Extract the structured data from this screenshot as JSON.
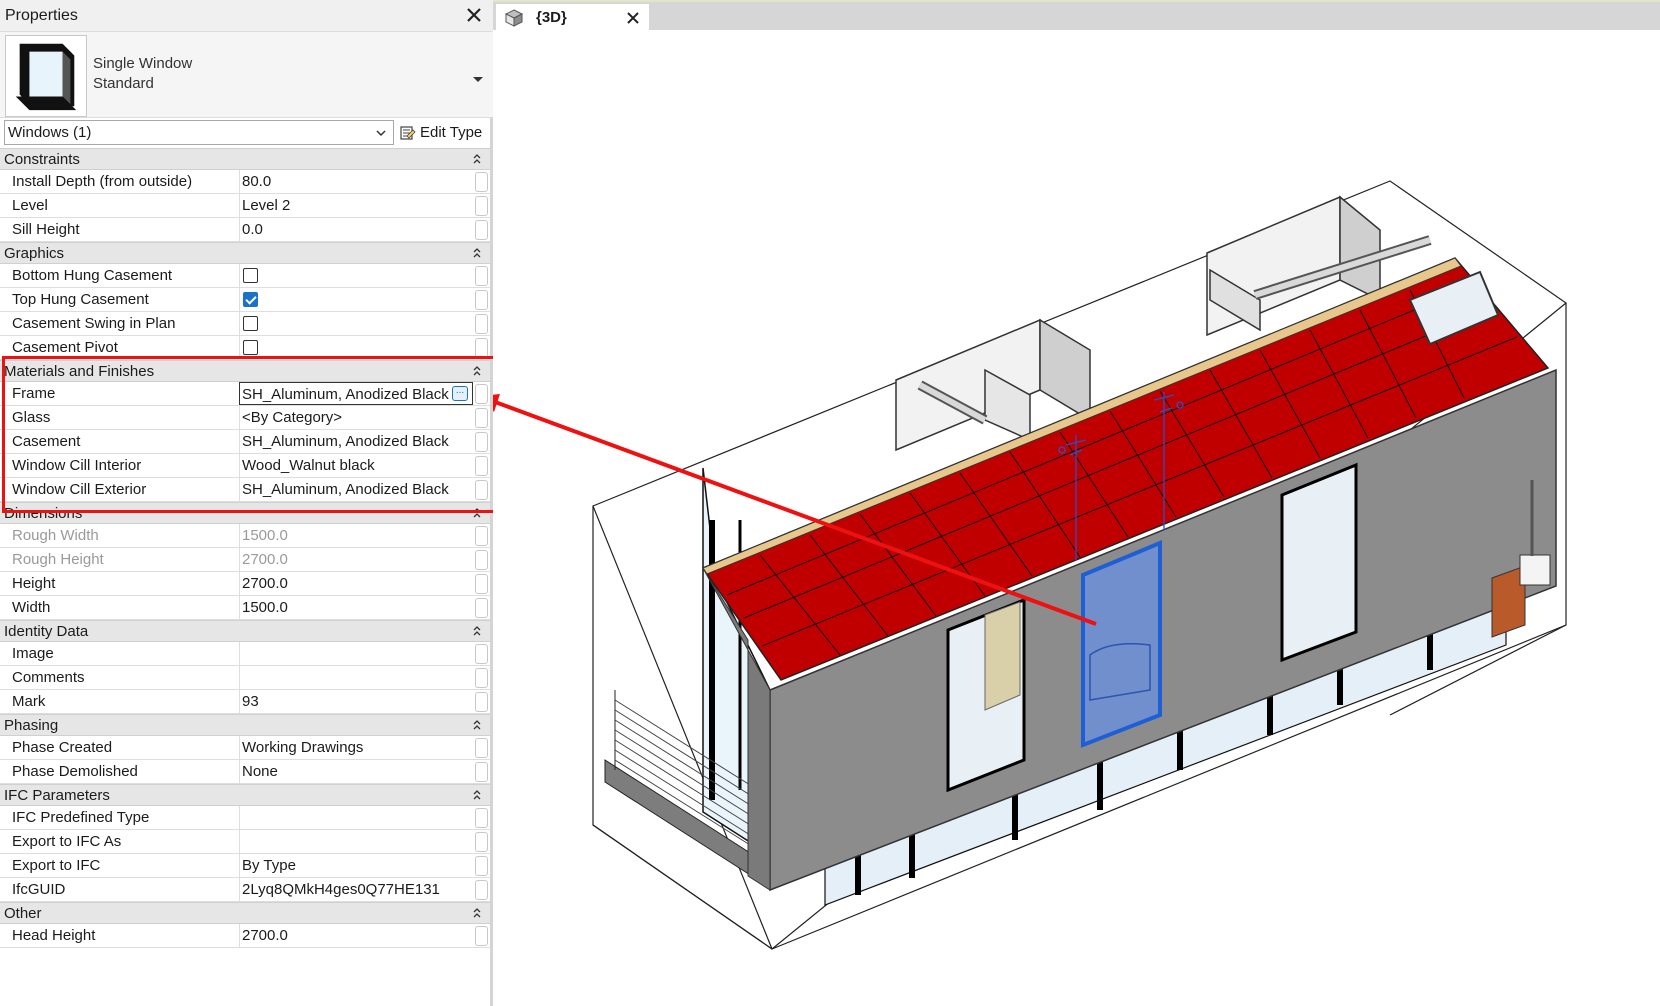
{
  "properties_panel": {
    "title": "Properties",
    "type": {
      "family": "Single Window",
      "type_name": "Standard"
    },
    "selector": {
      "value": "Windows (1)"
    },
    "edit_type_label": "Edit Type",
    "groups": [
      {
        "name": "Constraints",
        "rows": [
          {
            "name": "Install Depth (from outside)",
            "value": "80.0"
          },
          {
            "name": "Level",
            "value": "Level 2"
          },
          {
            "name": "Sill Height",
            "value": "0.0"
          }
        ]
      },
      {
        "name": "Graphics",
        "rows": [
          {
            "name": "Bottom Hung Casement",
            "checked": false
          },
          {
            "name": "Top Hung Casement",
            "checked": true
          },
          {
            "name": "Casement Swing in Plan",
            "checked": false
          },
          {
            "name": "Casement Pivot",
            "checked": false
          }
        ]
      },
      {
        "name": "Materials and Finishes",
        "rows": [
          {
            "name": "Frame",
            "value": "SH_Aluminum, Anodized Black",
            "active": true
          },
          {
            "name": "Glass",
            "value": "<By Category>"
          },
          {
            "name": "Casement",
            "value": "SH_Aluminum, Anodized Black"
          },
          {
            "name": "Window Cill Interior",
            "value": "Wood_Walnut black"
          },
          {
            "name": "Window Cill Exterior",
            "value": "SH_Aluminum, Anodized Black"
          }
        ]
      },
      {
        "name": "Dimensions",
        "rows": [
          {
            "name": "Rough Width",
            "value": "1500.0",
            "dim": true
          },
          {
            "name": "Rough Height",
            "value": "2700.0",
            "dim": true
          },
          {
            "name": "Height",
            "value": "2700.0"
          },
          {
            "name": "Width",
            "value": "1500.0"
          }
        ]
      },
      {
        "name": "Identity Data",
        "rows": [
          {
            "name": "Image",
            "value": ""
          },
          {
            "name": "Comments",
            "value": ""
          },
          {
            "name": "Mark",
            "value": "93"
          }
        ]
      },
      {
        "name": "Phasing",
        "rows": [
          {
            "name": "Phase Created",
            "value": "Working Drawings"
          },
          {
            "name": "Phase Demolished",
            "value": "None"
          }
        ]
      },
      {
        "name": "IFC Parameters",
        "rows": [
          {
            "name": "IFC Predefined Type",
            "value": ""
          },
          {
            "name": "Export to IFC As",
            "value": ""
          },
          {
            "name": "Export to IFC",
            "value": "By Type"
          },
          {
            "name": "IfcGUID",
            "value": "2Lyq8QMkH4ges0Q77HE131"
          }
        ]
      },
      {
        "name": "Other",
        "rows": [
          {
            "name": "Head Height",
            "value": "2700.0"
          }
        ]
      }
    ]
  },
  "view": {
    "tab_label": "{3D}"
  },
  "colors": {
    "highlight": "#ee1111",
    "roof": "#c00000",
    "wall": "#8c8c8c",
    "selected_window": "#1f5fd6",
    "checkbox_on": "#1a73c8"
  },
  "icons": [
    "close-icon",
    "window-type-thumbnail",
    "chevron-down-icon",
    "edit-type-icon",
    "collapse-icon",
    "cube-3d-icon",
    "browse-button-icon"
  ]
}
